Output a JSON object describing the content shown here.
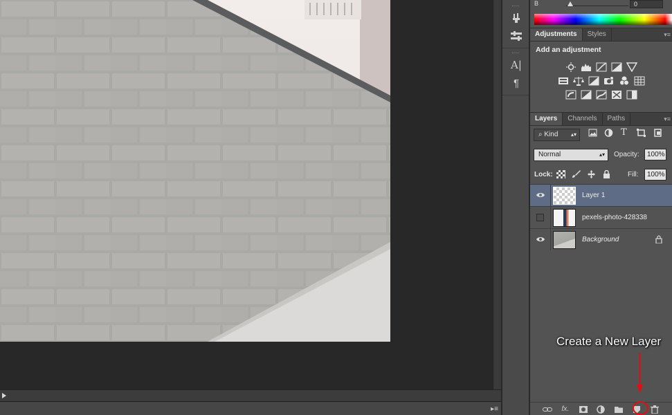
{
  "color_panel": {
    "channel_label": "B",
    "channel_value": "0"
  },
  "adjustments": {
    "tabs": [
      {
        "label": "Adjustments",
        "active": true
      },
      {
        "label": "Styles",
        "active": false
      }
    ],
    "header": "Add an adjustment",
    "icons_row1": [
      "brightness-contrast-icon",
      "levels-icon",
      "curves-icon",
      "exposure-icon",
      "vibrance-icon"
    ],
    "icons_row2": [
      "hue-saturation-icon",
      "color-balance-icon",
      "black-white-icon",
      "photo-filter-icon",
      "channel-mixer-icon",
      "color-lookup-icon"
    ],
    "icons_row3": [
      "invert-icon",
      "posterize-icon",
      "threshold-icon",
      "selective-color-icon",
      "gradient-map-icon"
    ]
  },
  "layers": {
    "tabs": [
      {
        "label": "Layers",
        "active": true
      },
      {
        "label": "Channels",
        "active": false
      },
      {
        "label": "Paths",
        "active": false
      }
    ],
    "filter": {
      "label": "Kind"
    },
    "blend_mode": "Normal",
    "opacity_label": "Opacity:",
    "opacity_value": "100%",
    "lock_label": "Lock:",
    "fill_label": "Fill:",
    "fill_value": "100%",
    "items": [
      {
        "name": "Layer 1",
        "visible": true,
        "selected": true,
        "locked": false,
        "italic": false
      },
      {
        "name": "pexels-photo-428338",
        "visible": false,
        "selected": false,
        "locked": false,
        "italic": false
      },
      {
        "name": "Background",
        "visible": true,
        "selected": false,
        "locked": true,
        "italic": true
      }
    ],
    "footer_icons": [
      "link-layers-icon",
      "fx-icon",
      "add-mask-icon",
      "adjustment-layer-icon",
      "new-group-icon",
      "new-layer-icon",
      "delete-layer-icon"
    ]
  },
  "tools_dock": [
    "brush-tool-icon",
    "tool-presets-icon",
    "character-icon",
    "paragraph-icon"
  ],
  "annotation": {
    "text": "Create a New Layer",
    "arrow_color": "#e01010"
  },
  "colors": {
    "accent_selected": "#5e6c85",
    "panel_bg": "#535353",
    "canvas_bg": "#282828",
    "annotation_red": "#e01010"
  }
}
